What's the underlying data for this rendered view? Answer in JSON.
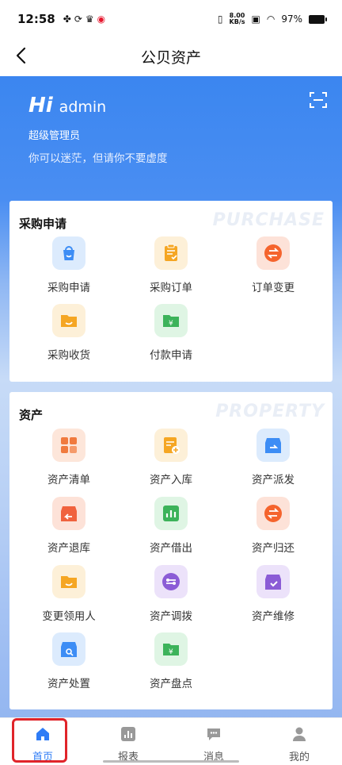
{
  "status_bar": {
    "time": "12:58",
    "net_speed": "8.00",
    "net_unit": "KB/s",
    "battery": "97%"
  },
  "nav": {
    "title": "公贝资产"
  },
  "header": {
    "greeting": "Hi",
    "username": "admin",
    "role": "超级管理员",
    "motto": "你可以迷茫，但请你不要虚度"
  },
  "purchase": {
    "title": "采购申请",
    "watermark": "PURCHASE",
    "items": [
      {
        "label": "采购申请",
        "icon": "shopping-bag-icon",
        "color": "#3d8df5"
      },
      {
        "label": "采购订单",
        "icon": "clipboard-icon",
        "color": "#f5a623"
      },
      {
        "label": "订单变更",
        "icon": "exchange-icon",
        "color": "#f5642d"
      },
      {
        "label": "采购收货",
        "icon": "folder-receive-icon",
        "color": "#f5a623"
      },
      {
        "label": "付款申请",
        "icon": "payment-folder-icon",
        "color": "#3cb35a"
      }
    ]
  },
  "property": {
    "title": "资产",
    "watermark": "PROPERTY",
    "items": [
      {
        "label": "资产清单",
        "icon": "grid-list-icon",
        "color": "#f07a3e"
      },
      {
        "label": "资产入库",
        "icon": "stock-in-icon",
        "color": "#f5a623"
      },
      {
        "label": "资产派发",
        "icon": "dispatch-box-icon",
        "color": "#3d8df5"
      },
      {
        "label": "资产退库",
        "icon": "return-box-icon",
        "color": "#f0623e"
      },
      {
        "label": "资产借出",
        "icon": "lend-chart-icon",
        "color": "#3cb35a"
      },
      {
        "label": "资产归还",
        "icon": "exchange-icon",
        "color": "#f5642d"
      },
      {
        "label": "变更领用人",
        "icon": "folder-user-icon",
        "color": "#f5a623"
      },
      {
        "label": "资产调拨",
        "icon": "transfer-icon",
        "color": "#8b5cd6"
      },
      {
        "label": "资产维修",
        "icon": "repair-icon",
        "color": "#8b5cd6"
      },
      {
        "label": "资产处置",
        "icon": "dispose-search-icon",
        "color": "#3d8df5"
      },
      {
        "label": "资产盘点",
        "icon": "inventory-folder-icon",
        "color": "#3cb35a"
      }
    ]
  },
  "tabs": [
    {
      "label": "首页",
      "icon": "home-icon",
      "active": true
    },
    {
      "label": "报表",
      "icon": "report-icon",
      "active": false
    },
    {
      "label": "消息",
      "icon": "message-icon",
      "active": false
    },
    {
      "label": "我的",
      "icon": "profile-icon",
      "active": false
    }
  ],
  "colors": {
    "primary": "#2f7cf6",
    "highlight": "#e0242a"
  }
}
